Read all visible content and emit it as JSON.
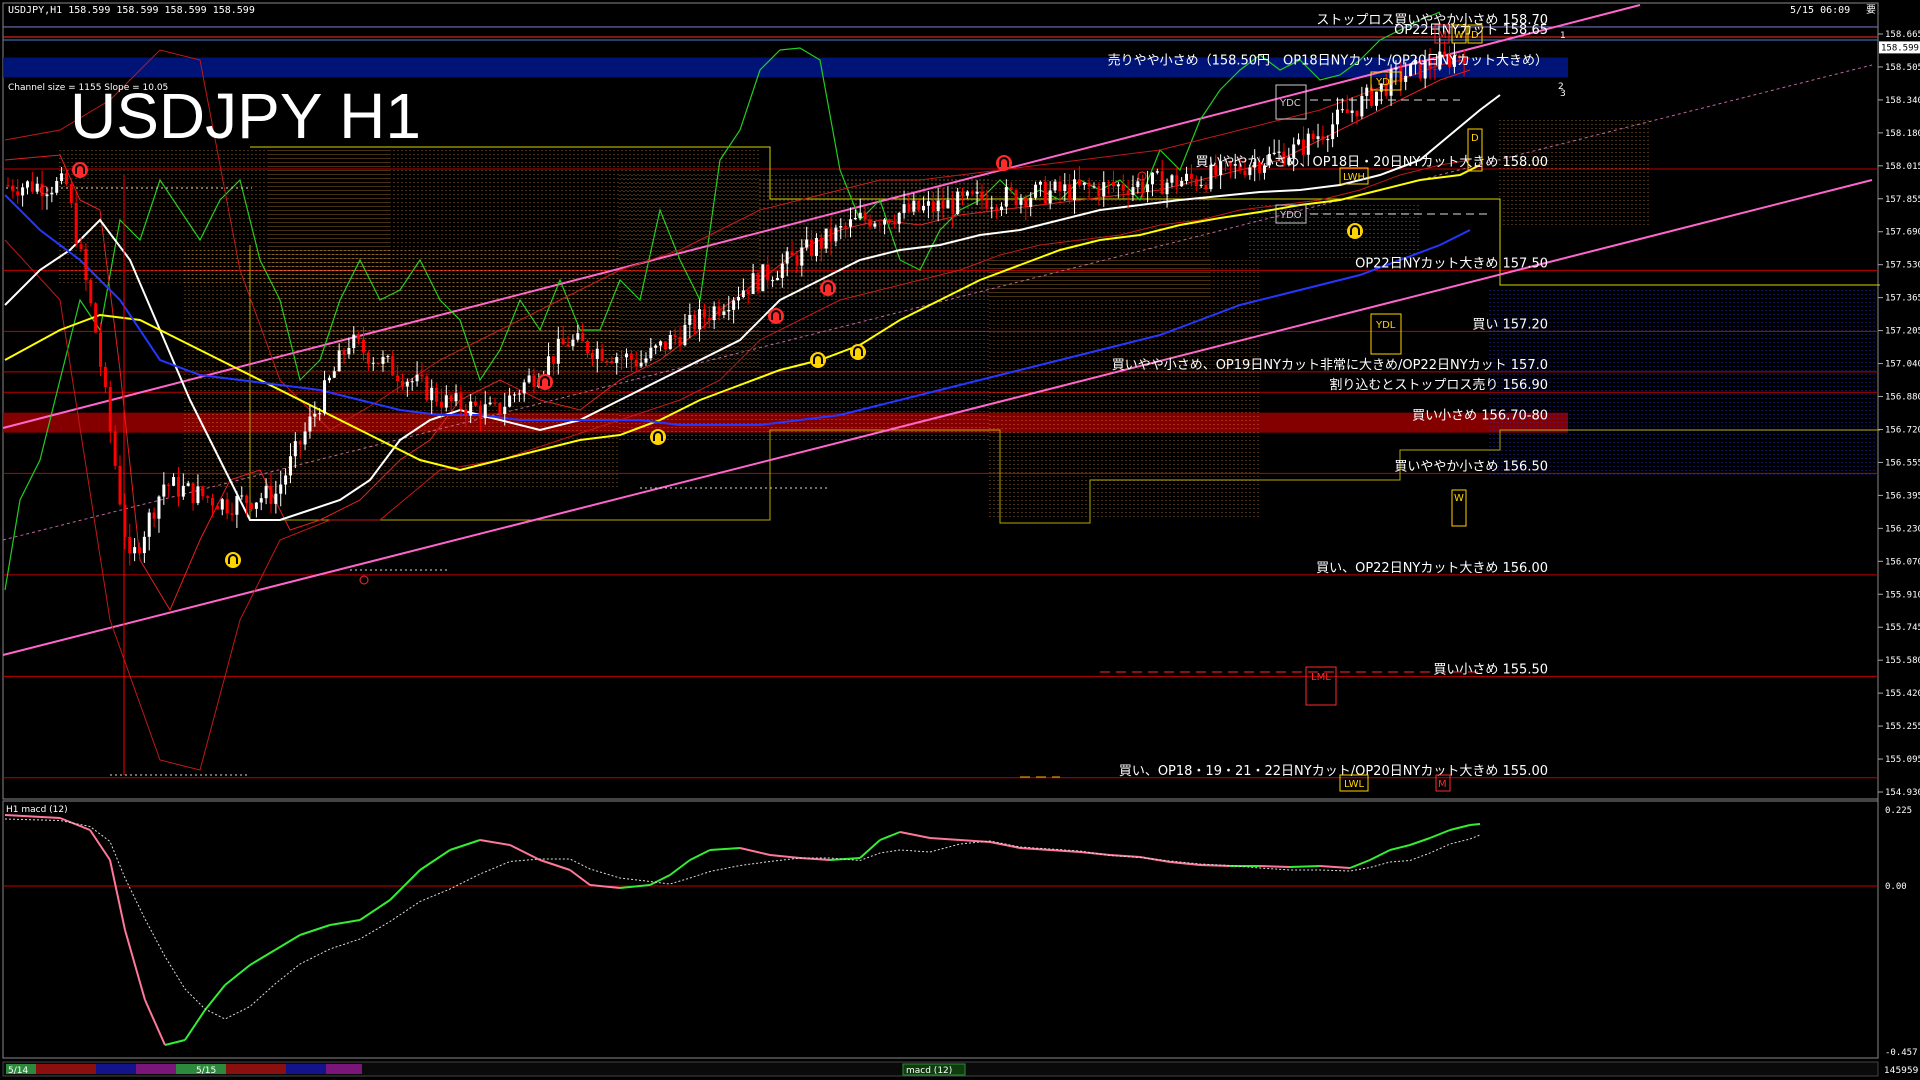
{
  "window": {
    "header": "USDJPY,H1  158.599 158.599 158.599 158.599",
    "timestamp": "5/15 06:09",
    "corner_label": "要",
    "channel_info": "Channel size = 1155 Slope = 10.05",
    "title": "USDJPY H1"
  },
  "levels": [
    {
      "label": "ストップロス買いややか小さめ 158.70",
      "price": 158.7,
      "color": "#ff2a2a"
    },
    {
      "label": "OP22日NYカット 158.65",
      "price": 158.65,
      "color": "#ff2a2a"
    },
    {
      "label": "売りやや小さめ（158.50円　OP18日NYカット/OP20日NYカット大きめ）",
      "price": 158.5,
      "color": "#00188c",
      "band": true
    },
    {
      "label": "買いややか小さめ、OP18日・20日NYカット大きめ 158.00",
      "price": 158.0,
      "color": "#c00000"
    },
    {
      "label": "OP22日NYカット大きめ 157.50",
      "price": 157.5,
      "color": "#c00000"
    },
    {
      "label": "買い 157.20",
      "price": 157.2,
      "color": "#c00000"
    },
    {
      "label": "買いやや小さめ、OP19日NYカット非常に大きめ/OP22日NYカット 157.0",
      "price": 157.0,
      "color": "#c00000"
    },
    {
      "label": "割り込むとストップロス売り 156.90",
      "price": 156.9,
      "color": "#c00000"
    },
    {
      "label": "買い小さめ 156.70-80",
      "price": 156.75,
      "color": "#9b0000",
      "band": true
    },
    {
      "label": "買いややか小さめ 156.50",
      "price": 156.5,
      "color": "#c00000"
    },
    {
      "label": "買い、OP22日NYカット大きめ 156.00",
      "price": 156.0,
      "color": "#c00000"
    },
    {
      "label": "買い小さめ 155.50",
      "price": 155.5,
      "color": "#c00000"
    },
    {
      "label": "買い、OP18・19・21・22日NYカット/OP20日NYカット大きめ 155.00",
      "price": 155.0,
      "color": "#c00000"
    }
  ],
  "price_axis": {
    "ticks": [
      "158.665",
      "158.505",
      "158.340",
      "158.180",
      "158.015",
      "157.855",
      "157.690",
      "157.530",
      "157.365",
      "157.205",
      "157.040",
      "156.880",
      "156.720",
      "156.555",
      "156.395",
      "156.230",
      "156.070",
      "155.910",
      "155.745",
      "155.580",
      "155.420",
      "155.255",
      "155.095",
      "154.930"
    ],
    "current_price": "158.599"
  },
  "macd": {
    "label": "H1  macd (12)",
    "ticks": [
      "0.225",
      "0.00",
      "-0.457"
    ],
    "footer_value": "145959"
  },
  "markers": {
    "ydh": "YDH",
    "ydc": "YDC",
    "ydo": "YDO",
    "ydl": "YDL",
    "lml": "LML",
    "d": "D",
    "w": "W",
    "m": "M",
    "lwh": "LWH",
    "lwl": "LWL",
    "wo": "WO",
    "lwl2": "LWL",
    "channel_1": "1",
    "channel_2": "2",
    "channel_3": "3"
  },
  "timeline": {
    "labels": [
      "5/14",
      "5/15"
    ],
    "scroll_label": "macd (12)"
  },
  "colors": {
    "background": "#000000",
    "bull_candle": "#ffffff",
    "bear_candle": "#ff0000",
    "channel": "#ff66cc",
    "ma_fast": "#ffffff",
    "ma_mid": "#ffff00",
    "ma_slow": "#1a1aff",
    "chikou": "#22cc22",
    "cloud": "#ffb347",
    "macd_up": "#33ee33",
    "macd_down": "#ff7799"
  }
}
